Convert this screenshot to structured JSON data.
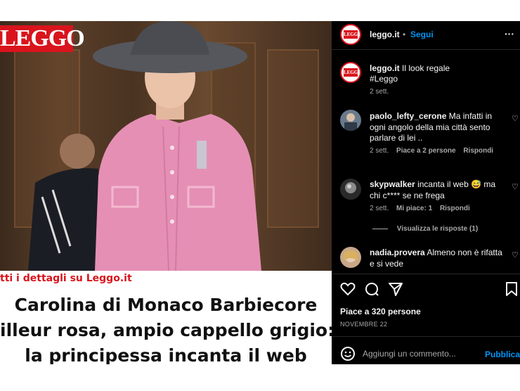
{
  "article": {
    "logo_text": "LEGGO",
    "caption": "tti i dettagli su Leggo.it",
    "headline_lines": [
      "Carolina di Monaco Barbiecore",
      "illeur rosa, ampio cappello grigio:",
      "la principessa incanta il web"
    ]
  },
  "post": {
    "username": "leggo.it",
    "follow_label": "Segui",
    "more_label": "···",
    "avatar_label": "LEGGO",
    "caption_text": "Il look regale",
    "caption_tag": "#Leggo",
    "caption_time": "2 sett.",
    "comments": [
      {
        "user": "paolo_lefty_cerone",
        "line1": "Ma infatti in",
        "line2": "ogni angolo della mia città sento",
        "line3": "parlare di lei ..",
        "time": "2 sett.",
        "likes": "Piace a 2 persone",
        "reply": "Rispondi"
      },
      {
        "user": "skypwalker",
        "line1": "incanta il web 😅 ma",
        "line2": "chi c**** se ne frega",
        "time": "2 sett.",
        "likes": "Mi piace: 1",
        "reply": "Rispondi",
        "view_replies": "Visualizza le risposte (1)"
      },
      {
        "user": "nadia.provera",
        "line1": "Almeno non è rifatta",
        "line2": "e si vede"
      }
    ],
    "likes_label": "Piace a 320 persone",
    "date_label": "NOVEMBRE 22",
    "comment_placeholder": "Aggiungi un commento...",
    "publish_label": "Pubblica",
    "heart_icon": "♡"
  },
  "colors": {
    "brand_red": "#d9141c",
    "instagram_blue": "#0095f6",
    "jacket_pink": "#e58fb5",
    "hat_grey": "#55575c"
  }
}
